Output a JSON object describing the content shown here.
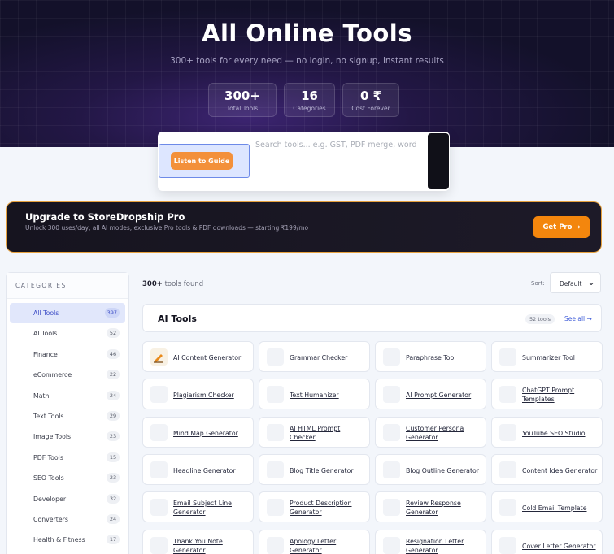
{
  "hero": {
    "title": "All Online Tools",
    "subtitle": "300+ tools for every need — no login, no signup, instant results",
    "stats": [
      {
        "value": "300+",
        "label": "Total Tools"
      },
      {
        "value": "16",
        "label": "Categories"
      },
      {
        "value": "0 ₹",
        "label": "Cost Forever"
      }
    ]
  },
  "search": {
    "guide_button": "Listen to Guide",
    "placeholder": "Search tools... e.g. GST, PDF merge, word count"
  },
  "promo": {
    "title": "Upgrade to StoreDropship Pro",
    "subtitle": "Unlock 300 uses/day, all AI modes, exclusive Pro tools & PDF downloads — starting ₹199/mo",
    "button": "Get Pro →"
  },
  "sidebar": {
    "heading": "CATEGORIES",
    "items": [
      {
        "label": "All Tools",
        "count": "397"
      },
      {
        "label": "AI Tools",
        "count": "52"
      },
      {
        "label": "Finance",
        "count": "46"
      },
      {
        "label": "eCommerce",
        "count": "22"
      },
      {
        "label": "Math",
        "count": "24"
      },
      {
        "label": "Text Tools",
        "count": "29"
      },
      {
        "label": "Image Tools",
        "count": "23"
      },
      {
        "label": "PDF Tools",
        "count": "15"
      },
      {
        "label": "SEO Tools",
        "count": "23"
      },
      {
        "label": "Developer",
        "count": "32"
      },
      {
        "label": "Converters",
        "count": "24"
      },
      {
        "label": "Health & Fitness",
        "count": "17"
      }
    ]
  },
  "results": {
    "found_count": "300+",
    "found_suffix": " tools found",
    "sort_label": "Sort:",
    "sort_value": "Default"
  },
  "section": {
    "title": "AI Tools",
    "count": "52 tools",
    "see_all": "See all →",
    "tools": [
      "AI Content Generator",
      "Grammar Checker",
      "Paraphrase Tool",
      "Summarizer Tool",
      "Plagiarism Checker",
      "Text Humanizer",
      "AI Prompt Generator",
      "ChatGPT Prompt Templates",
      "Mind Map Generator",
      "AI HTML Prompt Checker",
      "Customer Persona Generator",
      "YouTube SEO Studio",
      "Headline Generator",
      "Blog Title Generator",
      "Blog Outline Generator",
      "Content Idea Generator",
      "Email Subject Line Generator",
      "Product Description Generator",
      "Review Response Generator",
      "Cold Email Template",
      "Thank You Note Generator",
      "Apology Letter Generator",
      "Resignation Letter Generator",
      "Cover Letter Generator"
    ]
  },
  "colors": {
    "accent_orange": "#f3860d",
    "link_blue": "#3e5bd8",
    "active_bg": "#e1e7fb"
  }
}
